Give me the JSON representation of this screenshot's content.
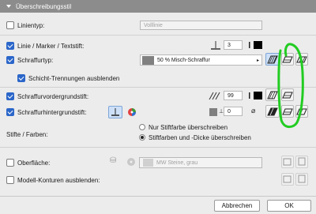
{
  "panel": {
    "title": "Überschreibungsstil"
  },
  "rows": {
    "linientyp": {
      "label": "Linientyp:",
      "value": "Volllinie"
    },
    "linie_stift": {
      "label": "Linie / Marker / Textstift:",
      "pen": "3"
    },
    "schraffurtyp": {
      "label": "Schraffurtyp:",
      "value": "50 % Misch-Schraffur"
    },
    "schicht": {
      "label": "Schicht-Trennungen ausblenden"
    },
    "vordergrund": {
      "label": "Schraffurvordergrundstift:",
      "pen": "99"
    },
    "hintergrund": {
      "label": "Schraffurhintergrundstift:",
      "pen": "0"
    },
    "stifte": {
      "label": "Stifte / Farben:",
      "option1": "Nur Stiftfarbe überschreiben",
      "option2": "Stiftfarben und -Dicke überschreiben"
    },
    "oberflaeche": {
      "label": "Oberfläche:",
      "value": "MW Steine, grau"
    },
    "modell": {
      "label": "Modell-Konturen ausblenden:"
    }
  },
  "footer": {
    "cancel": "Abbrechen",
    "ok": "OK"
  },
  "colors": {
    "highlight": "#22cc22",
    "checkbox": "#2b66c9",
    "header": "#8c8c8c"
  }
}
